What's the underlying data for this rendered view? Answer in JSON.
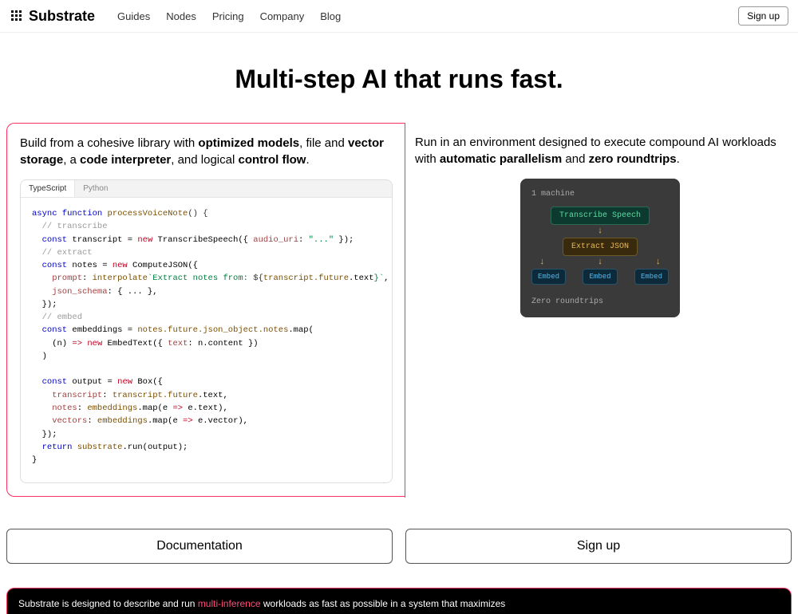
{
  "nav": {
    "brand": "Substrate",
    "links": [
      "Guides",
      "Nodes",
      "Pricing",
      "Company",
      "Blog"
    ],
    "signup": "Sign up"
  },
  "hero": {
    "title": "Multi-step AI that runs fast."
  },
  "feature_left": {
    "desc_pre": "Build from a cohesive library with ",
    "bold1": "optimized models",
    "mid1": ", file and ",
    "bold2": "vector storage",
    "mid2": ", a ",
    "bold3": "code interpreter",
    "mid3": ", and logical ",
    "bold4": "control flow",
    "tail": "."
  },
  "feature_right": {
    "desc_pre": "Run in an environment designed to execute compound AI workloads with ",
    "bold1": "automatic parallelism",
    "mid1": " and ",
    "bold2": "zero roundtrips",
    "tail": "."
  },
  "code_tabs": {
    "ts": "TypeScript",
    "py": "Python"
  },
  "code": {
    "l1a": "async function",
    "l1b": " processVoiceNote",
    "l1c": "() {",
    "l2": "  // transcribe",
    "l3a": "  const",
    "l3b": " transcript ",
    "l3c": "= ",
    "l3d": "new",
    "l3e": " TranscribeSpeech({ ",
    "l3f": "audio_uri",
    "l3g": ": ",
    "l3h": "\"...\"",
    "l3i": " });",
    "l4": "  // extract",
    "l5a": "  const",
    "l5b": " notes ",
    "l5c": "= ",
    "l5d": "new",
    "l5e": " ComputeJSON({",
    "l6a": "    prompt",
    "l6b": ": ",
    "l6c": "interpolate",
    "l6d": "`Extract notes from: ",
    "l6e": "${",
    "l6f": "transcript.future",
    "l6g": ".text",
    "l6h": "}`",
    "l6i": ",",
    "l7a": "    json_schema",
    "l7b": ": { ... },",
    "l8": "  });",
    "l9": "  // embed",
    "l10a": "  const",
    "l10b": " embeddings ",
    "l10c": "= ",
    "l10d": "notes.future.json_object.notes",
    "l10e": ".map(",
    "l11a": "    (n) ",
    "l11b": "=>",
    "l11c": " ",
    "l11d": "new",
    "l11e": " EmbedText({ ",
    "l11f": "text",
    "l11g": ": n.content })",
    "l12": "  )",
    "l13": "",
    "l14a": "  const",
    "l14b": " output ",
    "l14c": "= ",
    "l14d": "new",
    "l14e": " Box({",
    "l15a": "    transcript",
    "l15b": ": ",
    "l15c": "transcript.future",
    "l15d": ".text,",
    "l16a": "    notes",
    "l16b": ": ",
    "l16c": "embeddings",
    "l16d": ".map(e ",
    "l16e": "=>",
    "l16f": " e.text),",
    "l17a": "    vectors",
    "l17b": ": ",
    "l17c": "embeddings",
    "l17d": ".map(e ",
    "l17e": "=>",
    "l17f": " e.vector),",
    "l18": "  });",
    "l19a": "  return ",
    "l19b": "substrate",
    "l19c": ".run(output);",
    "l20": "}"
  },
  "diagram": {
    "header": "1 machine",
    "transcribe": "Transcribe Speech",
    "extract": "Extract JSON",
    "embed": "Embed",
    "footer": "Zero roundtrips"
  },
  "cta": {
    "docs": "Documentation",
    "signup": "Sign up"
  },
  "footer": {
    "pre": "Substrate is designed to describe and run ",
    "link": "multi-inference",
    "post": " workloads as fast as possible in a system that maximizes"
  }
}
